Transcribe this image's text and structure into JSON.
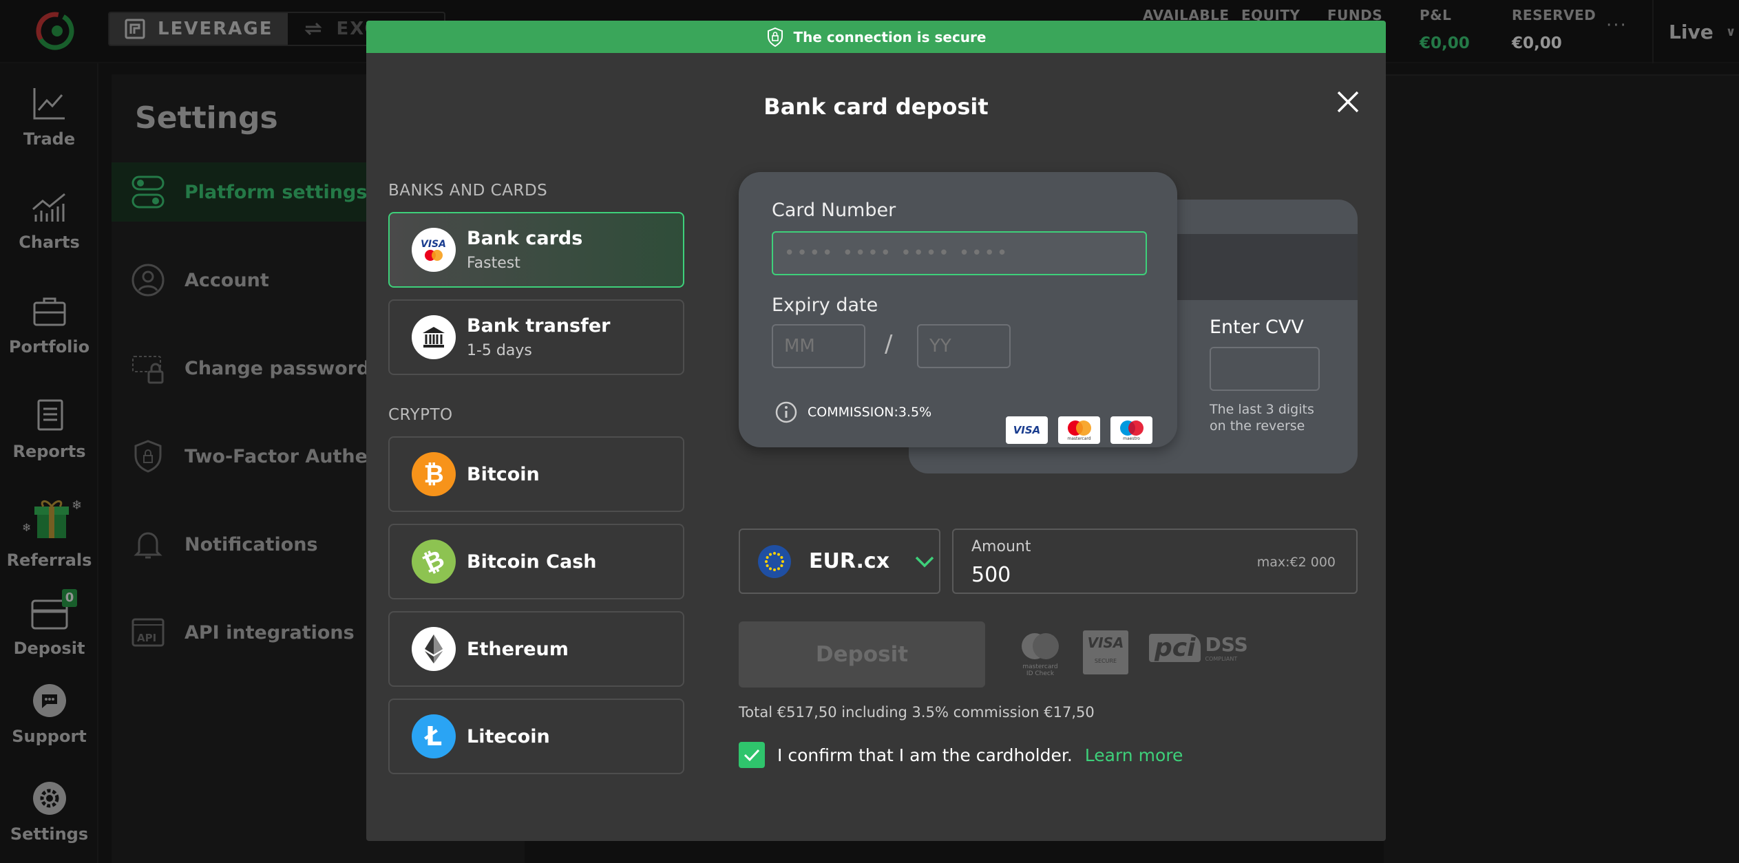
{
  "topbar": {
    "mode_leverage": "LEVERAGE",
    "mode_exchange": "EXCH",
    "stats": [
      {
        "label": "AVAILABLE",
        "value": ""
      },
      {
        "label": "EQUITY",
        "value": ""
      },
      {
        "label": "FUNDS",
        "value": ""
      },
      {
        "label": "P&L",
        "value": "€0,00"
      },
      {
        "label": "RESERVED",
        "value": "€0,00"
      }
    ],
    "more": "···",
    "account_type": "Live"
  },
  "sidebar": {
    "items": [
      {
        "label": "Trade",
        "icon": "trade-icon"
      },
      {
        "label": "Charts",
        "icon": "charts-icon"
      },
      {
        "label": "Portfolio",
        "icon": "portfolio-icon"
      },
      {
        "label": "Reports",
        "icon": "reports-icon"
      },
      {
        "label": "Referrals",
        "icon": "gift-icon"
      },
      {
        "label": "Deposit",
        "icon": "deposit-icon"
      },
      {
        "label": "Support",
        "icon": "support-icon"
      },
      {
        "label": "Settings",
        "icon": "settings-icon"
      }
    ],
    "referral_badge": "0"
  },
  "settings": {
    "title": "Settings",
    "items": [
      {
        "label": "Platform settings",
        "icon": "toggle-icon"
      },
      {
        "label": "Account",
        "icon": "user-icon"
      },
      {
        "label": "Change password",
        "icon": "password-icon"
      },
      {
        "label": "Two-Factor Authent",
        "icon": "shield-lock-icon"
      },
      {
        "label": "Notifications",
        "icon": "bell-icon"
      },
      {
        "label": "API integrations",
        "icon": "api-icon"
      }
    ]
  },
  "modal": {
    "secure_text": "The connection is secure",
    "title": "Bank card deposit",
    "banks_label": "BANKS AND CARDS",
    "crypto_label": "CRYPTO",
    "methods": [
      {
        "title": "Bank cards",
        "subtitle": "Fastest",
        "icon": "visa-mastercard-icon"
      },
      {
        "title": "Bank transfer",
        "subtitle": "1-5 days",
        "icon": "bank-icon"
      }
    ],
    "crypto": [
      {
        "title": "Bitcoin",
        "icon": "bitcoin-icon",
        "color": "#f7931a"
      },
      {
        "title": "Bitcoin Cash",
        "icon": "bitcoin-cash-icon",
        "color": "#8dc351"
      },
      {
        "title": "Ethereum",
        "icon": "ethereum-icon",
        "color": "#ffffff"
      },
      {
        "title": "Litecoin",
        "icon": "litecoin-icon",
        "color": "#2aa4f4"
      }
    ],
    "card": {
      "number_label": "Card Number",
      "number_placeholder": "•••• •••• •••• ••••",
      "expiry_label": "Expiry date",
      "month_placeholder": "MM",
      "year_placeholder": "YY",
      "slash": "/",
      "commission": "COMMISSION:3.5%",
      "cvv_label": "Enter CVV",
      "cvv_hint_1": "The last 3 digits",
      "cvv_hint_2": "on the reverse",
      "brands": [
        "VISA",
        "mastercard",
        "maestro"
      ]
    },
    "currency": "EUR.cx",
    "amount_label": "Amount",
    "amount_value": "500",
    "amount_max": "max:€2 000",
    "deposit_button": "Deposit",
    "trust": {
      "mc_line1": "mastercard",
      "mc_line2": "ID Check",
      "visa_main": "VISA",
      "visa_sub": "SECURE",
      "pci": "pci",
      "dss": "DSS",
      "dss_sub": "COMPLIANT"
    },
    "total_text": "Total €517,50 including 3.5% commission €17,50",
    "confirm_text": "I confirm that I am the cardholder.",
    "learn_more": "Learn more"
  },
  "colors": {
    "accent": "#3ed07a",
    "secure_bar": "#3aa65a",
    "modal_bg": "#373737",
    "card_bg": "#4e5257"
  }
}
